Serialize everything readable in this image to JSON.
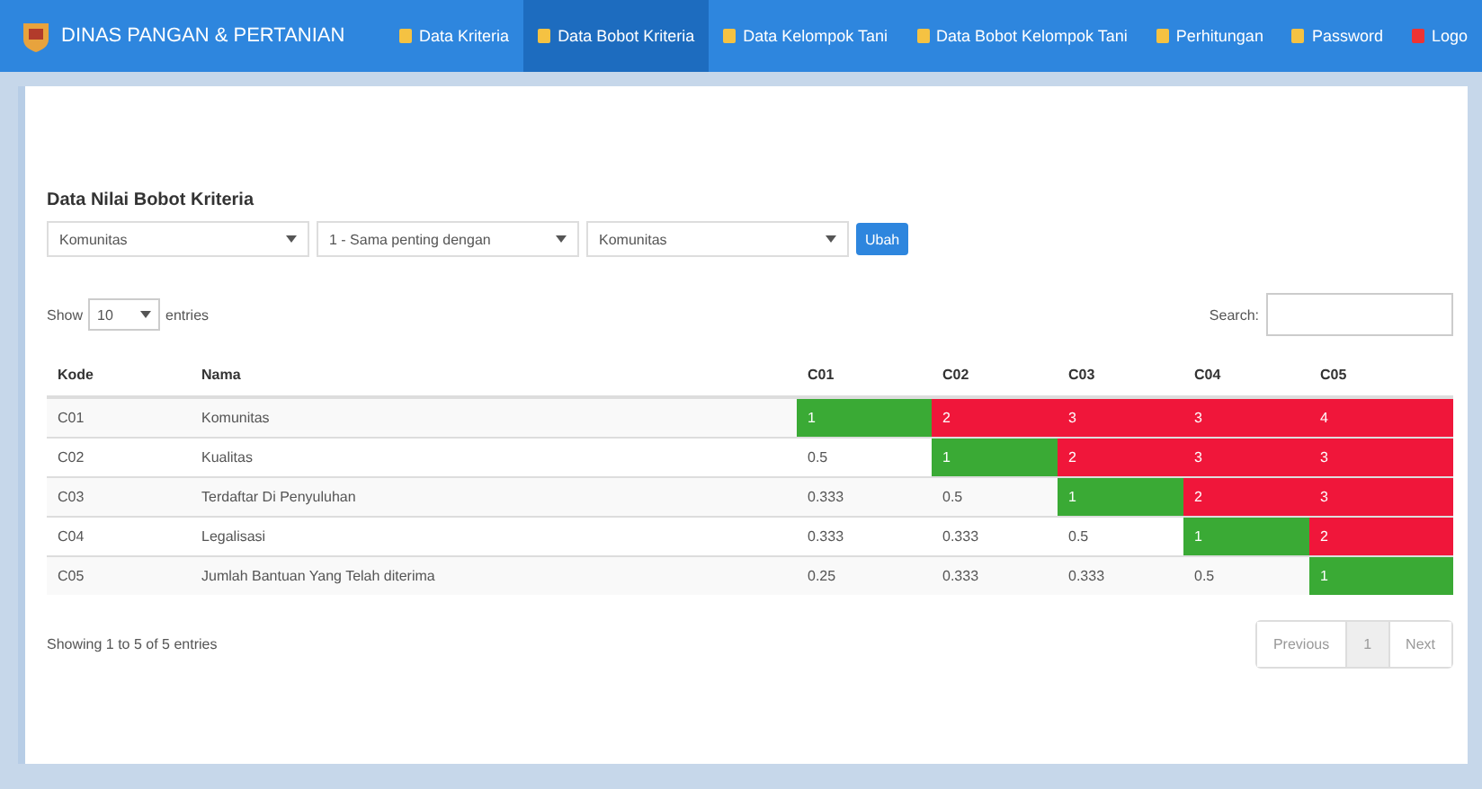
{
  "brand": {
    "title": "DINAS PANGAN & PERTANIAN"
  },
  "nav": [
    {
      "label": "Data Kriteria",
      "selected": false
    },
    {
      "label": "Data Bobot Kriteria",
      "selected": true
    },
    {
      "label": "Data Kelompok Tani",
      "selected": false
    },
    {
      "label": "Data Bobot Kelompok Tani",
      "selected": false
    },
    {
      "label": "Perhitungan",
      "selected": false
    },
    {
      "label": "Password",
      "selected": false
    },
    {
      "label": "Logo",
      "selected": false
    }
  ],
  "panel": {
    "title": "Data Nilai Bobot Kriteria"
  },
  "form": {
    "selects": [
      "Komunitas",
      "1 - Sama penting dengan",
      "Komunitas"
    ],
    "button": "Ubah"
  },
  "length": {
    "before": "Show",
    "value": "10",
    "after": "entries"
  },
  "search": {
    "label": "Search:"
  },
  "table": {
    "columns": [
      "Kode",
      "Nama",
      "C01",
      "C02",
      "C03",
      "C04",
      "C05"
    ],
    "rows": [
      {
        "cells": [
          {
            "value": "C01"
          },
          {
            "value": "Komunitas"
          },
          {
            "value": "1",
            "color": "#3aaa35"
          },
          {
            "value": "2",
            "color": "#f0163a"
          },
          {
            "value": "3",
            "color": "#f0163a"
          },
          {
            "value": "3",
            "color": "#f0163a"
          },
          {
            "value": "4",
            "color": "#f0163a"
          }
        ]
      },
      {
        "cells": [
          {
            "value": "C02"
          },
          {
            "value": "Kualitas"
          },
          {
            "value": "0.5"
          },
          {
            "value": "1",
            "color": "#3aaa35"
          },
          {
            "value": "2",
            "color": "#f0163a"
          },
          {
            "value": "3",
            "color": "#f0163a"
          },
          {
            "value": "3",
            "color": "#f0163a"
          }
        ]
      },
      {
        "cells": [
          {
            "value": "C03"
          },
          {
            "value": "Terdaftar Di Penyuluhan"
          },
          {
            "value": "0.333"
          },
          {
            "value": "0.5"
          },
          {
            "value": "1",
            "color": "#3aaa35"
          },
          {
            "value": "2",
            "color": "#f0163a"
          },
          {
            "value": "3",
            "color": "#f0163a"
          }
        ]
      },
      {
        "cells": [
          {
            "value": "C04"
          },
          {
            "value": "Legalisasi"
          },
          {
            "value": "0.333"
          },
          {
            "value": "0.333"
          },
          {
            "value": "0.5"
          },
          {
            "value": "1",
            "color": "#3aaa35"
          },
          {
            "value": "2",
            "color": "#f0163a"
          }
        ]
      },
      {
        "cells": [
          {
            "value": "C05"
          },
          {
            "value": "Jumlah Bantuan Yang Telah diterima"
          },
          {
            "value": "0.25"
          },
          {
            "value": "0.333"
          },
          {
            "value": "0.333"
          },
          {
            "value": "0.5"
          },
          {
            "value": "1",
            "color": "#3aaa35"
          }
        ]
      }
    ]
  },
  "info": "Showing 1 to 5 of 5 entries",
  "pagination": [
    {
      "label": "Previous",
      "selected": false
    },
    {
      "label": "1",
      "selected": true
    },
    {
      "label": "Next",
      "selected": false
    }
  ]
}
